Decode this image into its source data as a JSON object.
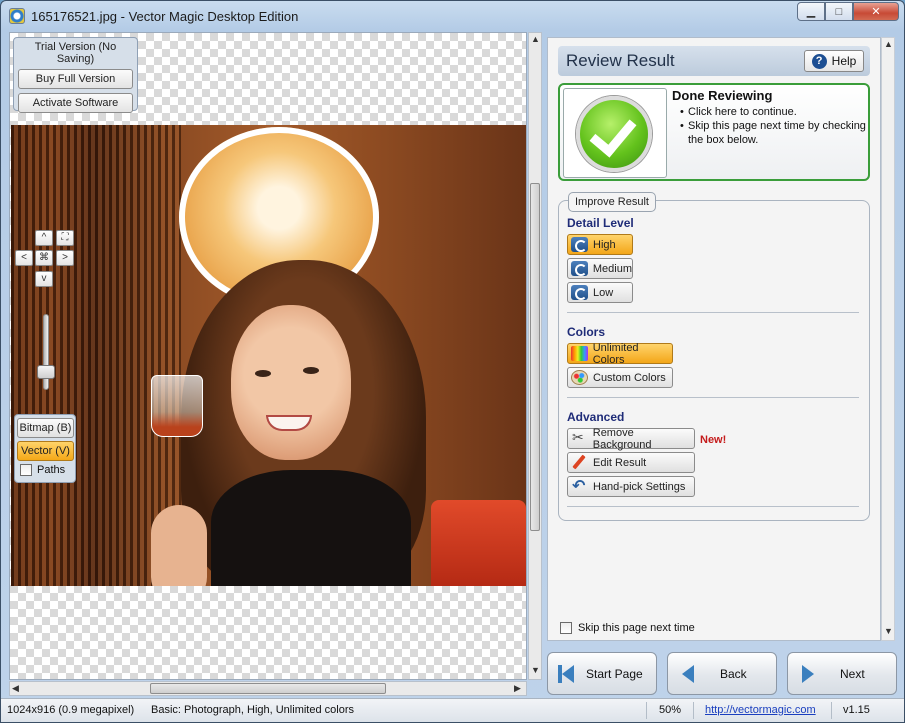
{
  "window": {
    "title": "165176521.jpg - Vector Magic Desktop Edition",
    "minimize": "▁",
    "maximize": "□",
    "close": "✕"
  },
  "trial": {
    "label": "Trial Version (No Saving)",
    "buy_label": "Buy Full Version",
    "activate_label": "Activate Software"
  },
  "navpad": {
    "up": "^",
    "down": "v",
    "left": "<",
    "right": ">",
    "center": "⌘",
    "fit": "⛶"
  },
  "view": {
    "bitmap_label": "Bitmap (B)",
    "vector_label": "Vector (V)",
    "paths_label": "Paths",
    "active": "vector"
  },
  "panel": {
    "title": "Review Result",
    "help_label": "Help",
    "done_title": "Done Reviewing",
    "done_items": [
      "Click here to continue.",
      "Skip this page next time by checking the box below."
    ],
    "improve_tab": "Improve Result",
    "detail_label": "Detail Level",
    "detail_options": [
      "High",
      "Medium",
      "Low"
    ],
    "detail_selected": "High",
    "colors_label": "Colors",
    "color_options": [
      "Unlimited Colors",
      "Custom Colors"
    ],
    "colors_selected": "Unlimited Colors",
    "advanced_label": "Advanced",
    "advanced_options": [
      "Remove Background",
      "Edit Result",
      "Hand-pick Settings"
    ],
    "new_badge": "New!",
    "skip_label": "Skip this page next time"
  },
  "nav": {
    "start_label": "Start Page",
    "back_label": "Back",
    "next_label": "Next"
  },
  "status": {
    "image_info": "1024x916 (0.9 megapixel)",
    "settings": "Basic: Photograph, High, Unlimited colors",
    "zoom": "50%",
    "url": "http://vectormagic.com",
    "version": "v1.15"
  },
  "colors": {
    "accent_active": "#f4a818",
    "done_border": "#3a9d3a",
    "section_label": "#1f2c78",
    "new_badge": "#c41b1b"
  }
}
